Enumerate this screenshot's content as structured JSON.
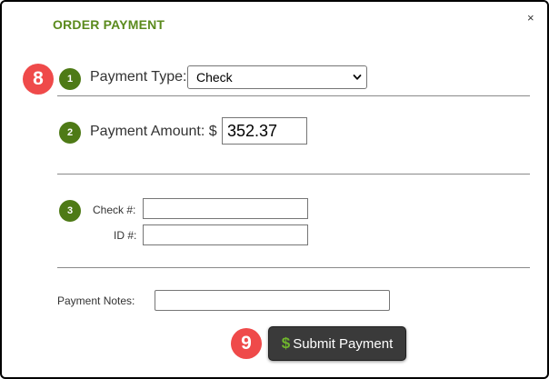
{
  "dialog": {
    "title": "ORDER PAYMENT",
    "close_glyph": "×"
  },
  "markers": {
    "first": "8",
    "second": "9"
  },
  "payment_type": {
    "step": "1",
    "label": "Payment Type:",
    "selected": "Check",
    "icon": "chevron-down-icon"
  },
  "payment_amount": {
    "step": "2",
    "label": "Payment Amount: $",
    "value": "352.37"
  },
  "check_details": {
    "step": "3",
    "check_label": "Check #:",
    "check_value": "",
    "id_label": "ID #:",
    "id_value": ""
  },
  "notes": {
    "label": "Payment Notes:",
    "value": ""
  },
  "submit": {
    "icon_glyph": "$",
    "label": "Submit Payment"
  },
  "colors": {
    "title_green": "#5a8a1c",
    "step_green": "#4e7a16",
    "marker_red": "#ef4a4a",
    "button_dark": "#3a3a3a",
    "dollar_green": "#6fb52c"
  }
}
